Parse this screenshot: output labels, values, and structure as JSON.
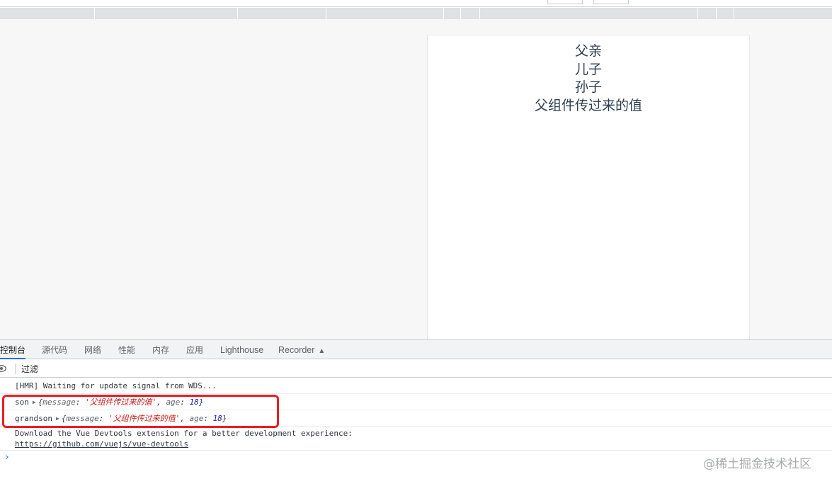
{
  "page": {
    "lines": [
      "父亲",
      "儿子",
      "孙子",
      "父组件传过来的值"
    ]
  },
  "devtools": {
    "tabs": [
      {
        "label": "控制台",
        "active": true
      },
      {
        "label": "源代码",
        "active": false
      },
      {
        "label": "网络",
        "active": false
      },
      {
        "label": "性能",
        "active": false
      },
      {
        "label": "内存",
        "active": false
      },
      {
        "label": "应用",
        "active": false
      },
      {
        "label": "Lighthouse",
        "active": false
      },
      {
        "label": "Recorder",
        "active": false
      }
    ],
    "filter": {
      "placeholder": "过滤"
    },
    "console": {
      "hmr": "[HMR] Waiting for update signal from WDS...",
      "son": {
        "label": "son",
        "key1": "message",
        "value1": "'父组件传过来的值'",
        "key2": "age",
        "value2": "18"
      },
      "grandson": {
        "label": "grandson",
        "key1": "message",
        "value1": "'父组件传过来的值'",
        "key2": "age",
        "value2": "18"
      },
      "download": "Download the Vue Devtools extension for a better development experience:",
      "link": "https://github.com/vuejs/vue-devtools"
    },
    "prompt": "›"
  },
  "watermark": "@稀土掘金技术社区",
  "colors": {
    "highlight": "#ee1c24",
    "active_tab": "#1a73e8",
    "string_value": "#c41a16",
    "number_value": "#1a1aa6"
  }
}
